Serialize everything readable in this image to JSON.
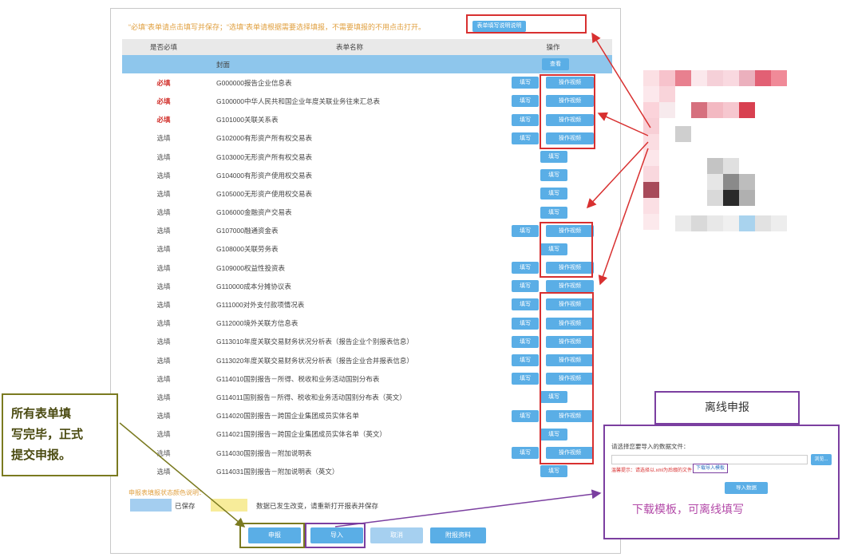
{
  "notice": {
    "text": "“必填”表单请点击填写并保存；“选填”表单请根据需要选择填报，不需要填报的不用点击打开。",
    "guide_button": "表单填写说明说明"
  },
  "table": {
    "headers": [
      "是否必填",
      "表单名称",
      "操作"
    ],
    "cover_row": {
      "name": "封面",
      "action": "查看"
    },
    "rows": [
      {
        "req": "必填",
        "name": "G000000报告企业信息表",
        "fill": "填写",
        "video": "操作视频",
        "required": true
      },
      {
        "req": "必填",
        "name": "G100000中华人民共和国企业年度关联业务往来汇总表",
        "fill": "填写",
        "video": "操作视频",
        "required": true
      },
      {
        "req": "必填",
        "name": "G101000关联关系表",
        "fill": "填写",
        "video": "操作视频",
        "required": true
      },
      {
        "req": "选填",
        "name": "G102000有形资产所有权交易表",
        "fill": "填写",
        "video": "操作视频"
      },
      {
        "req": "选填",
        "name": "G103000无形资产所有权交易表",
        "fill": "填写"
      },
      {
        "req": "选填",
        "name": "G104000有形资产使用权交易表",
        "fill": "填写"
      },
      {
        "req": "选填",
        "name": "G105000无形资产使用权交易表",
        "fill": "填写"
      },
      {
        "req": "选填",
        "name": "G106000金融资产交易表",
        "fill": "填写"
      },
      {
        "req": "选填",
        "name": "G107000融通资金表",
        "fill": "填写",
        "video": "操作视频"
      },
      {
        "req": "选填",
        "name": "G108000关联劳务表",
        "fill": "填写"
      },
      {
        "req": "选填",
        "name": "G109000权益性投资表",
        "fill": "填写",
        "video": "操作视频"
      },
      {
        "req": "选填",
        "name": "G110000成本分摊协议表",
        "fill": "填写",
        "video": "操作视频"
      },
      {
        "req": "选填",
        "name": "G111000对外支付款项情况表",
        "fill": "填写",
        "video": "操作视频"
      },
      {
        "req": "选填",
        "name": "G112000境外关联方信息表",
        "fill": "填写",
        "video": "操作视频"
      },
      {
        "req": "选填",
        "name": "G113010年度关联交易财务状况分析表（报告企业个别报表信息）",
        "fill": "填写",
        "video": "操作视频"
      },
      {
        "req": "选填",
        "name": "G113020年度关联交易财务状况分析表（报告企业合并报表信息）",
        "fill": "填写",
        "video": "操作视频"
      },
      {
        "req": "选填",
        "name": "G114010国别报告－所得、税收和业务活动国别分布表",
        "fill": "填写",
        "video": "操作视频"
      },
      {
        "req": "选填",
        "name": "G114011国别报告－所得、税收和业务活动国别分布表（英文）",
        "fill": "填写"
      },
      {
        "req": "选填",
        "name": "G114020国别报告－跨国企业集团成员实体名单",
        "fill": "填写",
        "video": "操作视频"
      },
      {
        "req": "选填",
        "name": "G114021国别报告－跨国企业集团成员实体名单（英文）",
        "fill": "填写"
      },
      {
        "req": "选填",
        "name": "G114030国别报告－附加说明表",
        "fill": "填写",
        "video": "操作视频"
      },
      {
        "req": "选填",
        "name": "G114031国别报告－附加说明表（英文）",
        "fill": "填写"
      }
    ]
  },
  "legend": {
    "title": "申报表填报状态颜色说明：",
    "saved": "已保存",
    "changed": "数据已发生改变，请重新打开报表并保存"
  },
  "buttons": {
    "submit": "申报",
    "import": "导入",
    "cancel": "取消",
    "attach": "附报资料"
  },
  "callout_left": {
    "line1": "所有表单填",
    "line2": "写完毕，正式",
    "line3": "提交申报。"
  },
  "offline": {
    "title": "离线申报",
    "prompt": "请选择您要导入的数据文件：",
    "browse": "浏览...",
    "warning": "温馨提示：请选择以.xml为后缀的文件！",
    "download": "下载导入模板",
    "import_btn": "导入数据",
    "caption": "下载模板，可离线填写"
  },
  "colors": {
    "button_blue": "#5aaee6",
    "required_red": "#d2322d",
    "annotation_red": "#d83030",
    "annotation_purple": "#7b3fa0",
    "annotation_olive": "#7a7a20"
  }
}
